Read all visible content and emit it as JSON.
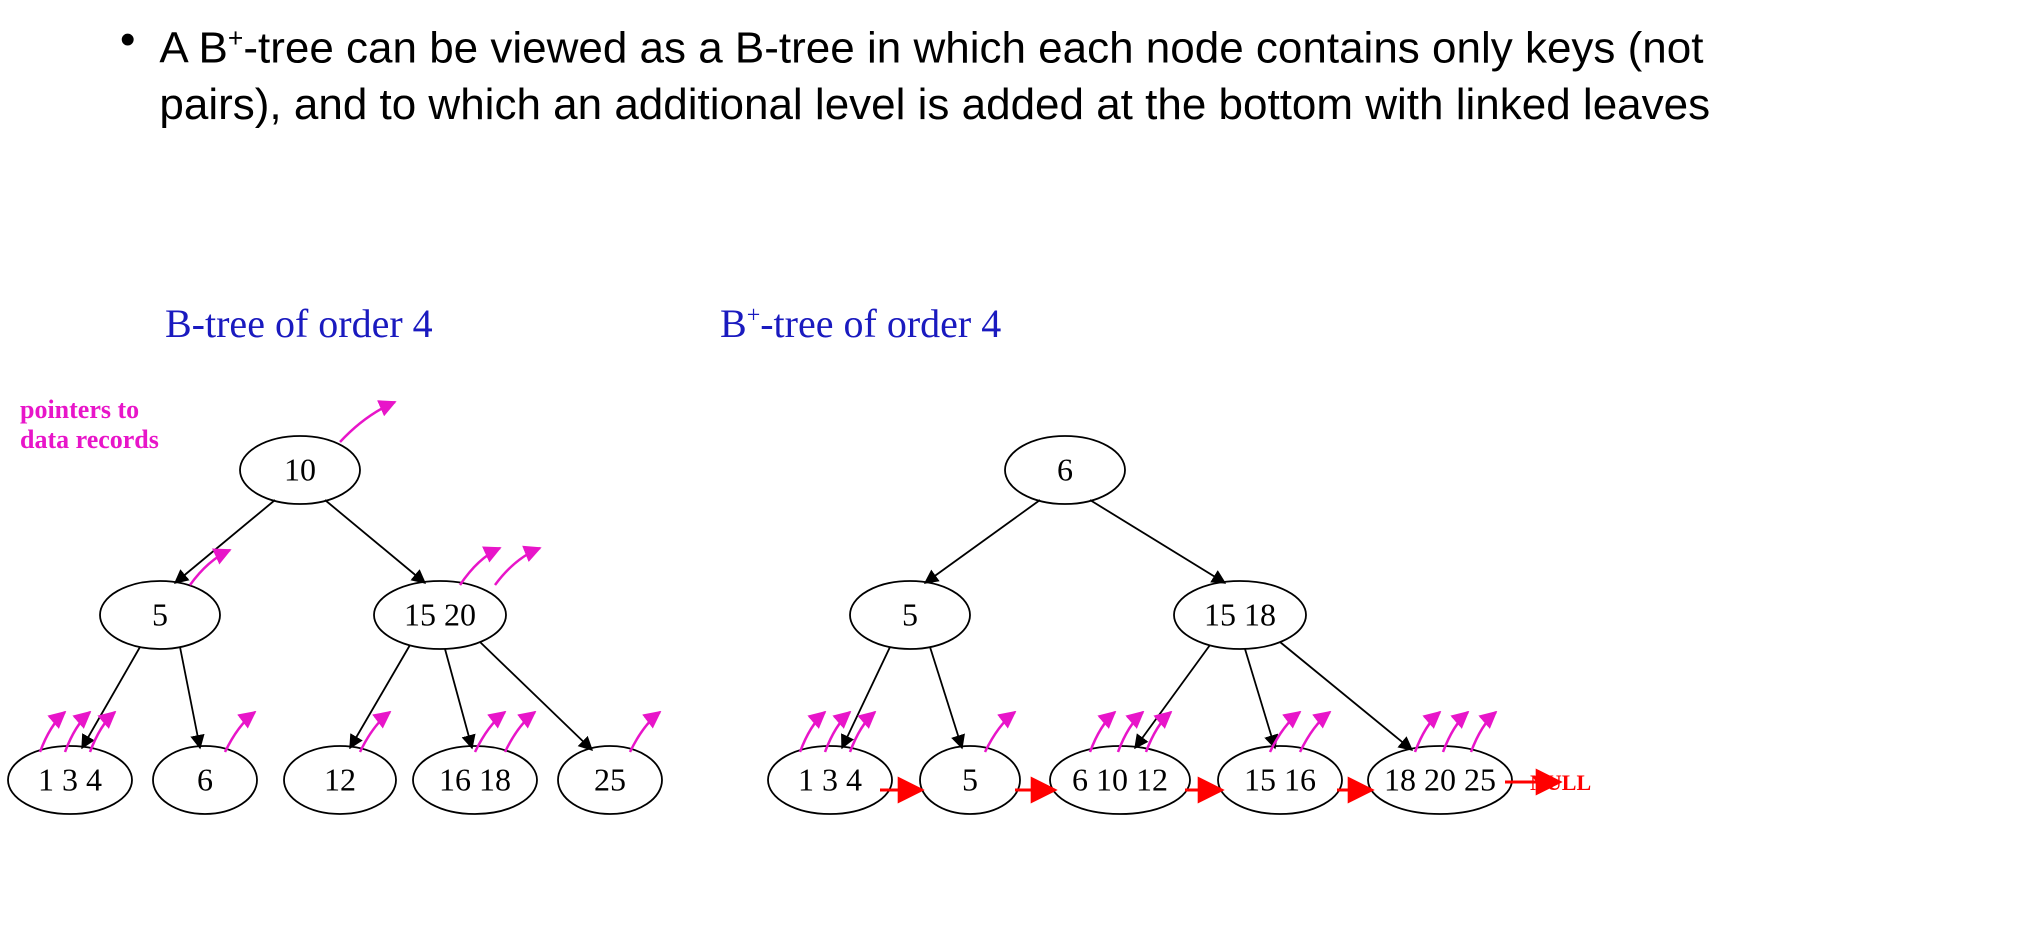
{
  "bullet": "A B⁺-tree can be viewed as a B-tree in which each node contains only keys (not pairs), and to which an additional level is added at the bottom with linked leaves",
  "left_title": "B-tree of order 4",
  "right_title_pre": "B",
  "right_title_sup": "+",
  "right_title_post": "-tree of order 4",
  "pointers_label_line1": "pointers to",
  "pointers_label_line2": "data records",
  "null_label": "NULL",
  "btree": {
    "root": "10",
    "l1a": "5",
    "l1b": "15 20",
    "leaf1": "1 3 4",
    "leaf2": "6",
    "leaf3": "12",
    "leaf4": "16 18",
    "leaf5": "25"
  },
  "bplus": {
    "root": "6",
    "l1a": "5",
    "l1b": "15 18",
    "leaf1": "1 3 4",
    "leaf2": "5",
    "leaf3": "6 10 12",
    "leaf4": "15 16",
    "leaf5": "18 20 25"
  },
  "chart_data": {
    "type": "diagram",
    "description": "Comparison of a B-tree of order 4 and a B+-tree of order 4 built on the same key set.",
    "keys": [
      1,
      3,
      4,
      5,
      6,
      10,
      12,
      15,
      16,
      18,
      20,
      25
    ],
    "btree": {
      "order": 4,
      "root": {
        "keys": [
          10
        ]
      },
      "level1": [
        {
          "keys": [
            5
          ],
          "parent_key_side": "left"
        },
        {
          "keys": [
            15,
            20
          ],
          "parent_key_side": "right"
        }
      ],
      "leaves": [
        {
          "keys": [
            1,
            3,
            4
          ]
        },
        {
          "keys": [
            6
          ]
        },
        {
          "keys": [
            12
          ]
        },
        {
          "keys": [
            16,
            18
          ]
        },
        {
          "keys": [
            25
          ]
        }
      ],
      "data_record_pointers": "every key in every node points to its data record"
    },
    "bplus_tree": {
      "order": 4,
      "root": {
        "keys": [
          6
        ]
      },
      "level1": [
        {
          "keys": [
            5
          ]
        },
        {
          "keys": [
            15,
            18
          ]
        }
      ],
      "leaves_linked_list": [
        {
          "keys": [
            1,
            3,
            4
          ]
        },
        {
          "keys": [
            5
          ]
        },
        {
          "keys": [
            6,
            10,
            12
          ]
        },
        {
          "keys": [
            15,
            16
          ]
        },
        {
          "keys": [
            18,
            20,
            25
          ]
        }
      ],
      "leaf_next_terminator": "NULL",
      "data_record_pointers": "only leaf keys point to data records"
    }
  }
}
